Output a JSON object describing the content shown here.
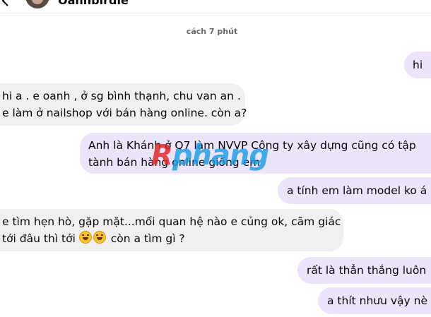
{
  "header": {
    "contact_name": "Oanhbirdie",
    "back_icon": "chevron-left-icon"
  },
  "timestamp": "cách 7 phút",
  "messages": [
    {
      "direction": "outgoing",
      "lines": [
        "hi"
      ]
    },
    {
      "direction": "incoming",
      "lines": [
        "hi a . e oanh , ở sg bình thạnh, chu van an .",
        "e làm ở nailshop với bán hàng online. còn a?"
      ]
    },
    {
      "direction": "outgoing",
      "lines": [
        "Anh là Khánh ở Q7 làm NVVP Công ty xây dựng cũng có tập",
        "tành bán hàng online giống em"
      ]
    },
    {
      "direction": "outgoing",
      "lines": [
        "a tính em làm model ko á"
      ]
    },
    {
      "direction": "incoming",
      "lines": [
        "e tìm hẹn hò, gặp mặt...mối quan hệ nào e củng ok, cãm giác",
        "tới đâu thì tới",
        "còn a tìm gì ?"
      ],
      "emojis": [
        "laughing-face-emoji",
        "laughing-face-emoji"
      ]
    },
    {
      "direction": "outgoing",
      "lines": [
        "rất là thẳn thắng luôn"
      ]
    },
    {
      "direction": "outgoing",
      "lines": [
        "a thít nhưu vậy nè"
      ]
    }
  ],
  "watermark": {
    "first": "R",
    "rest": "phang"
  },
  "colors": {
    "incoming_bubble": "#f0f0f0",
    "outgoing_bubble": "#ece4fb",
    "timestamp": "#65676b"
  }
}
